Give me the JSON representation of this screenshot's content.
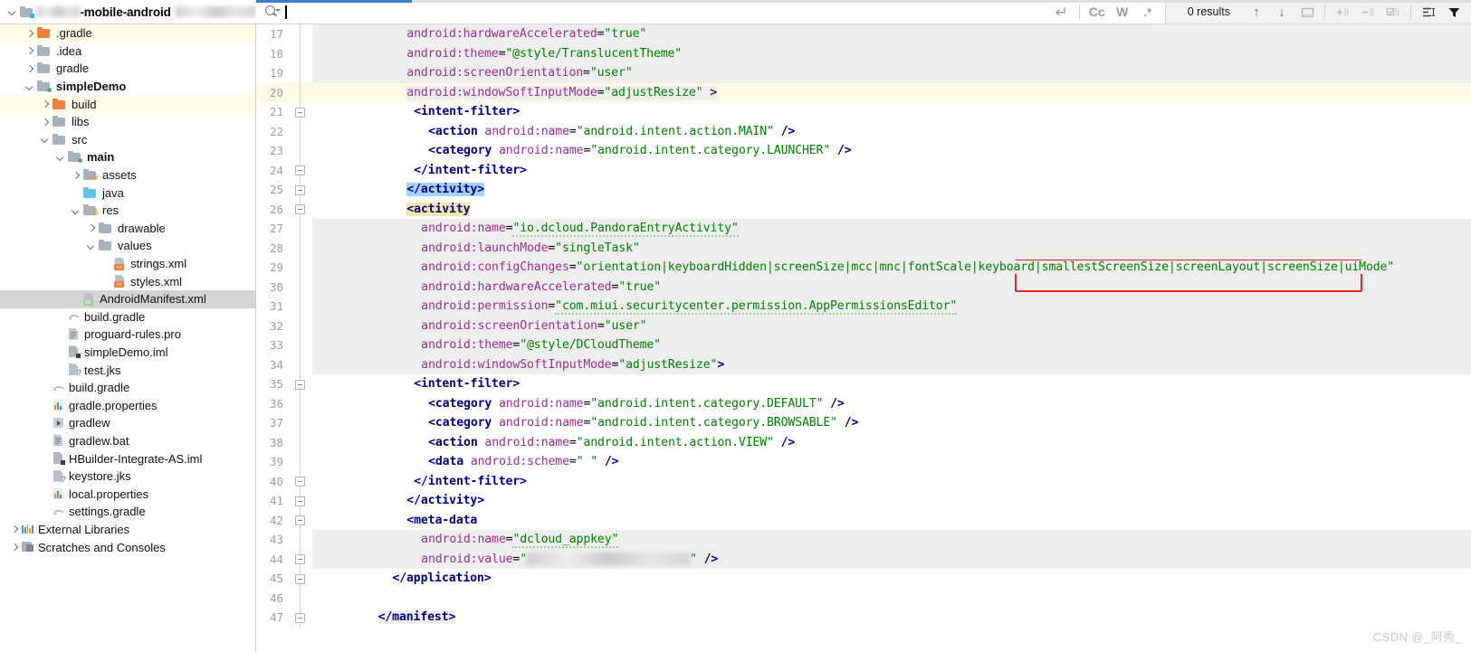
{
  "window": {
    "project_label": "-mobile-android",
    "watermark": "CSDN @_阿秀_"
  },
  "search_toolbar": {
    "query_value": "",
    "match_case_label": "Cc",
    "words_label": "W",
    "regex_label": ".*",
    "results_label": "0 results",
    "prev_icon": "arrow-up-icon",
    "next_icon": "arrow-down-icon",
    "select_all_icon": "select-all-icon",
    "add_icon": "add-occurrence-icon",
    "remove_icon": "remove-occurrence-icon",
    "select_occurrences_icon": "select-all-occurrences-icon",
    "preview_icon": "preview-icon",
    "filter_icon": "filter-icon",
    "new_line_icon": "newline-icon"
  },
  "sidebar": {
    "items": [
      {
        "label": ".gradle",
        "indent": 1,
        "icon": "folder-orange",
        "twisty": "right",
        "bold": false,
        "highlight": "yellow"
      },
      {
        "label": ".idea",
        "indent": 1,
        "icon": "folder-gray",
        "twisty": "right",
        "bold": false,
        "highlight": "none"
      },
      {
        "label": "gradle",
        "indent": 1,
        "icon": "folder-gray",
        "twisty": "right",
        "bold": false,
        "highlight": "none"
      },
      {
        "label": "simpleDemo",
        "indent": 1,
        "icon": "folder-module",
        "twisty": "down",
        "bold": true,
        "highlight": "none"
      },
      {
        "label": "build",
        "indent": 2,
        "icon": "folder-orange",
        "twisty": "right",
        "bold": false,
        "highlight": "yellow"
      },
      {
        "label": "libs",
        "indent": 2,
        "icon": "folder-gray",
        "twisty": "right",
        "bold": false,
        "highlight": "none"
      },
      {
        "label": "src",
        "indent": 2,
        "icon": "folder-gray",
        "twisty": "down",
        "bold": false,
        "highlight": "none"
      },
      {
        "label": "main",
        "indent": 3,
        "icon": "folder-module",
        "twisty": "down",
        "bold": true,
        "highlight": "none"
      },
      {
        "label": "assets",
        "indent": 4,
        "icon": "folder-res",
        "twisty": "right",
        "bold": false,
        "highlight": "none"
      },
      {
        "label": "java",
        "indent": 4,
        "icon": "folder-blue",
        "twisty": "none",
        "bold": false,
        "highlight": "none"
      },
      {
        "label": "res",
        "indent": 4,
        "icon": "folder-res",
        "twisty": "down",
        "bold": false,
        "highlight": "none"
      },
      {
        "label": "drawable",
        "indent": 5,
        "icon": "folder-gray",
        "twisty": "right",
        "bold": false,
        "highlight": "none"
      },
      {
        "label": "values",
        "indent": 5,
        "icon": "folder-gray",
        "twisty": "down",
        "bold": false,
        "highlight": "none"
      },
      {
        "label": "strings.xml",
        "indent": 6,
        "icon": "file-xml",
        "twisty": "none",
        "bold": false,
        "highlight": "none"
      },
      {
        "label": "styles.xml",
        "indent": 6,
        "icon": "file-xml",
        "twisty": "none",
        "bold": false,
        "highlight": "none"
      },
      {
        "label": "AndroidManifest.xml",
        "indent": 4,
        "icon": "file-manifest",
        "twisty": "none",
        "bold": false,
        "highlight": "selected"
      },
      {
        "label": "build.gradle",
        "indent": 3,
        "icon": "file-gradle",
        "twisty": "none",
        "bold": false,
        "highlight": "none"
      },
      {
        "label": "proguard-rules.pro",
        "indent": 3,
        "icon": "file-doc",
        "twisty": "none",
        "bold": false,
        "highlight": "none"
      },
      {
        "label": "simpleDemo.iml",
        "indent": 3,
        "icon": "file-iml",
        "twisty": "none",
        "bold": false,
        "highlight": "none"
      },
      {
        "label": "test.jks",
        "indent": 3,
        "icon": "file-jks",
        "twisty": "none",
        "bold": false,
        "highlight": "none"
      },
      {
        "label": "build.gradle",
        "indent": 2,
        "icon": "file-gradle",
        "twisty": "none",
        "bold": false,
        "highlight": "none"
      },
      {
        "label": "gradle.properties",
        "indent": 2,
        "icon": "file-props",
        "twisty": "none",
        "bold": false,
        "highlight": "none"
      },
      {
        "label": "gradlew",
        "indent": 2,
        "icon": "file-gradlew",
        "twisty": "none",
        "bold": false,
        "highlight": "none"
      },
      {
        "label": "gradlew.bat",
        "indent": 2,
        "icon": "file-doc",
        "twisty": "none",
        "bold": false,
        "highlight": "none"
      },
      {
        "label": "HBuilder-Integrate-AS.iml",
        "indent": 2,
        "icon": "file-iml",
        "twisty": "none",
        "bold": false,
        "highlight": "none"
      },
      {
        "label": "keystore.jks",
        "indent": 2,
        "icon": "file-jks",
        "twisty": "none",
        "bold": false,
        "highlight": "none"
      },
      {
        "label": "local.properties",
        "indent": 2,
        "icon": "file-props",
        "twisty": "none",
        "bold": false,
        "highlight": "none"
      },
      {
        "label": "settings.gradle",
        "indent": 2,
        "icon": "file-gradle",
        "twisty": "none",
        "bold": false,
        "highlight": "none"
      },
      {
        "label": "External Libraries",
        "indent": 0,
        "icon": "libraries",
        "twisty": "right",
        "bold": false,
        "highlight": "none"
      },
      {
        "label": "Scratches and Consoles",
        "indent": 0,
        "icon": "scratches",
        "twisty": "right",
        "bold": false,
        "highlight": "none"
      }
    ]
  },
  "editor": {
    "annotation": {
      "type": "red-rectangle",
      "color": "#e8232b",
      "covers_text": "smallestScreenSize|screenLayout|screenSize|uiMode\""
    },
    "current_line": 20,
    "selection_text": "</activity>",
    "lines": [
      {
        "n": 17,
        "indent": 10,
        "bg": "gray",
        "fold": "none",
        "tokens": [
          {
            "t": "attr",
            "s": "android:hardwareAccelerated"
          },
          {
            "t": "eq",
            "s": "="
          },
          {
            "t": "val",
            "s": "\"true\""
          }
        ]
      },
      {
        "n": 18,
        "indent": 10,
        "bg": "gray",
        "fold": "none",
        "tokens": [
          {
            "t": "attr",
            "s": "android:theme"
          },
          {
            "t": "eq",
            "s": "="
          },
          {
            "t": "val",
            "s": "\"@style/TranslucentTheme\""
          }
        ]
      },
      {
        "n": 19,
        "indent": 10,
        "bg": "gray",
        "fold": "none",
        "tokens": [
          {
            "t": "attr",
            "s": "android:screenOrientation"
          },
          {
            "t": "eq",
            "s": "="
          },
          {
            "t": "val",
            "s": "\"user\""
          }
        ]
      },
      {
        "n": 20,
        "indent": 10,
        "bg": "none",
        "fold": "none",
        "current": true,
        "tokens": [
          {
            "t": "attr",
            "s": "android:windowSoftInputMode"
          },
          {
            "t": "eq",
            "s": "="
          },
          {
            "t": "val",
            "s": "\"adjustResize\""
          },
          {
            "t": "plain",
            "s": " >"
          }
        ]
      },
      {
        "n": 21,
        "indent": 11,
        "bg": "white",
        "fold": "top",
        "tokens": [
          {
            "t": "tag",
            "s": "<intent-filter>"
          }
        ]
      },
      {
        "n": 22,
        "indent": 13,
        "bg": "white",
        "fold": "none",
        "tokens": [
          {
            "t": "tag",
            "s": "<action "
          },
          {
            "t": "attr",
            "s": "android:name"
          },
          {
            "t": "eq",
            "s": "="
          },
          {
            "t": "val",
            "s": "\"android.intent.action.MAIN\""
          },
          {
            "t": "tag",
            "s": " />"
          }
        ]
      },
      {
        "n": 23,
        "indent": 13,
        "bg": "white",
        "fold": "none",
        "tokens": [
          {
            "t": "tag",
            "s": "<category "
          },
          {
            "t": "attr",
            "s": "android:name"
          },
          {
            "t": "eq",
            "s": "="
          },
          {
            "t": "val",
            "s": "\"android.intent.category.LAUNCHER\""
          },
          {
            "t": "tag",
            "s": " />"
          }
        ]
      },
      {
        "n": 24,
        "indent": 11,
        "bg": "white",
        "fold": "bot",
        "tokens": [
          {
            "t": "tag",
            "s": "</intent-filter>"
          }
        ]
      },
      {
        "n": 25,
        "indent": 10,
        "bg": "white",
        "fold": "bot",
        "select": "blue",
        "tokens": [
          {
            "t": "tag",
            "s": "</activity>"
          }
        ]
      },
      {
        "n": 26,
        "indent": 10,
        "bg": "white",
        "fold": "top",
        "select": "tan",
        "tokens": [
          {
            "t": "tag",
            "s": "<activity"
          }
        ]
      },
      {
        "n": 27,
        "indent": 12,
        "bg": "gray",
        "fold": "none",
        "tokens": [
          {
            "t": "attr",
            "s": "android:name"
          },
          {
            "t": "eq",
            "s": "="
          },
          {
            "t": "val-wavy",
            "s": "\"io.dcloud.PandoraEntryActivity\""
          }
        ]
      },
      {
        "n": 28,
        "indent": 12,
        "bg": "gray",
        "fold": "none",
        "tokens": [
          {
            "t": "attr",
            "s": "android:launchMode"
          },
          {
            "t": "eq",
            "s": "="
          },
          {
            "t": "val",
            "s": "\"singleTask\""
          }
        ]
      },
      {
        "n": 29,
        "indent": 12,
        "bg": "gray",
        "fold": "none",
        "tokens": [
          {
            "t": "attr",
            "s": "android:configChanges"
          },
          {
            "t": "eq",
            "s": "="
          },
          {
            "t": "val",
            "s": "\"orientation|keyboardHidden|screenSize|mcc|mnc|fontScale|keyboard|smallestScreenSize|screenLayout|screenSize|uiMode\""
          }
        ]
      },
      {
        "n": 30,
        "indent": 12,
        "bg": "gray",
        "fold": "none",
        "tokens": [
          {
            "t": "attr",
            "s": "android:hardwareAccelerated"
          },
          {
            "t": "eq",
            "s": "="
          },
          {
            "t": "val",
            "s": "\"true\""
          }
        ]
      },
      {
        "n": 31,
        "indent": 12,
        "bg": "gray",
        "fold": "none",
        "tokens": [
          {
            "t": "attr",
            "s": "android:permission"
          },
          {
            "t": "eq",
            "s": "="
          },
          {
            "t": "val-wavy",
            "s": "\"com.miui.securitycenter.permission.AppPermissionsEditor\""
          }
        ]
      },
      {
        "n": 32,
        "indent": 12,
        "bg": "gray",
        "fold": "none",
        "tokens": [
          {
            "t": "attr",
            "s": "android:screenOrientation"
          },
          {
            "t": "eq",
            "s": "="
          },
          {
            "t": "val",
            "s": "\"user\""
          }
        ]
      },
      {
        "n": 33,
        "indent": 12,
        "bg": "gray",
        "fold": "none",
        "tokens": [
          {
            "t": "attr",
            "s": "android:theme"
          },
          {
            "t": "eq",
            "s": "="
          },
          {
            "t": "val",
            "s": "\"@style/DCloudTheme\""
          }
        ]
      },
      {
        "n": 34,
        "indent": 12,
        "bg": "gray",
        "fold": "none",
        "tokens": [
          {
            "t": "attr",
            "s": "android:windowSoftInputMode"
          },
          {
            "t": "eq",
            "s": "="
          },
          {
            "t": "val",
            "s": "\"adjustResize\""
          },
          {
            "t": "tag",
            "s": ">"
          }
        ]
      },
      {
        "n": 35,
        "indent": 11,
        "bg": "white",
        "fold": "top",
        "tokens": [
          {
            "t": "tag",
            "s": "<intent-filter>"
          }
        ]
      },
      {
        "n": 36,
        "indent": 13,
        "bg": "white",
        "fold": "none",
        "tokens": [
          {
            "t": "tag",
            "s": "<category "
          },
          {
            "t": "attr",
            "s": "android:name"
          },
          {
            "t": "eq",
            "s": "="
          },
          {
            "t": "val",
            "s": "\"android.intent.category.DEFAULT\""
          },
          {
            "t": "tag",
            "s": " />"
          }
        ]
      },
      {
        "n": 37,
        "indent": 13,
        "bg": "white",
        "fold": "none",
        "tokens": [
          {
            "t": "tag",
            "s": "<category "
          },
          {
            "t": "attr",
            "s": "android:name"
          },
          {
            "t": "eq",
            "s": "="
          },
          {
            "t": "val",
            "s": "\"android.intent.category.BROWSABLE\""
          },
          {
            "t": "tag",
            "s": " />"
          }
        ]
      },
      {
        "n": 38,
        "indent": 13,
        "bg": "white",
        "fold": "none",
        "tokens": [
          {
            "t": "tag",
            "s": "<action "
          },
          {
            "t": "attr",
            "s": "android:name"
          },
          {
            "t": "eq",
            "s": "="
          },
          {
            "t": "val",
            "s": "\"android.intent.action.VIEW\""
          },
          {
            "t": "tag",
            "s": " />"
          }
        ]
      },
      {
        "n": 39,
        "indent": 13,
        "bg": "white",
        "fold": "none",
        "tokens": [
          {
            "t": "tag",
            "s": "<data "
          },
          {
            "t": "attr",
            "s": "android:scheme"
          },
          {
            "t": "eq",
            "s": "="
          },
          {
            "t": "val",
            "s": "\" \""
          },
          {
            "t": "tag",
            "s": " />"
          }
        ]
      },
      {
        "n": 40,
        "indent": 11,
        "bg": "white",
        "fold": "bot",
        "tokens": [
          {
            "t": "tag",
            "s": "</intent-filter>"
          }
        ]
      },
      {
        "n": 41,
        "indent": 10,
        "bg": "white",
        "fold": "bot",
        "tokens": [
          {
            "t": "tag",
            "s": "</activity>"
          }
        ]
      },
      {
        "n": 42,
        "indent": 10,
        "bg": "white",
        "fold": "top",
        "tokens": [
          {
            "t": "tag",
            "s": "<meta-data"
          }
        ]
      },
      {
        "n": 43,
        "indent": 12,
        "bg": "gray",
        "fold": "none",
        "tokens": [
          {
            "t": "attr",
            "s": "android:name"
          },
          {
            "t": "eq",
            "s": "="
          },
          {
            "t": "val-wavy",
            "s": "\"dcloud_appkey\""
          }
        ]
      },
      {
        "n": 44,
        "indent": 12,
        "bg": "gray",
        "fold": "bot",
        "tokens": [
          {
            "t": "attr",
            "s": "android:value"
          },
          {
            "t": "eq",
            "s": "="
          },
          {
            "t": "val",
            "s": "\""
          },
          {
            "t": "blur",
            "s": "redacted-appkey"
          },
          {
            "t": "val",
            "s": "\""
          },
          {
            "t": "tag",
            "s": " />"
          }
        ]
      },
      {
        "n": 45,
        "indent": 8,
        "bg": "white",
        "fold": "bot",
        "tokens": [
          {
            "t": "tag",
            "s": "</application>"
          }
        ]
      },
      {
        "n": 46,
        "indent": 0,
        "bg": "none",
        "fold": "none",
        "tokens": []
      },
      {
        "n": 47,
        "indent": 6,
        "bg": "none",
        "fold": "bot",
        "tokens": [
          {
            "t": "tag",
            "s": "</manifest>"
          }
        ]
      }
    ]
  }
}
